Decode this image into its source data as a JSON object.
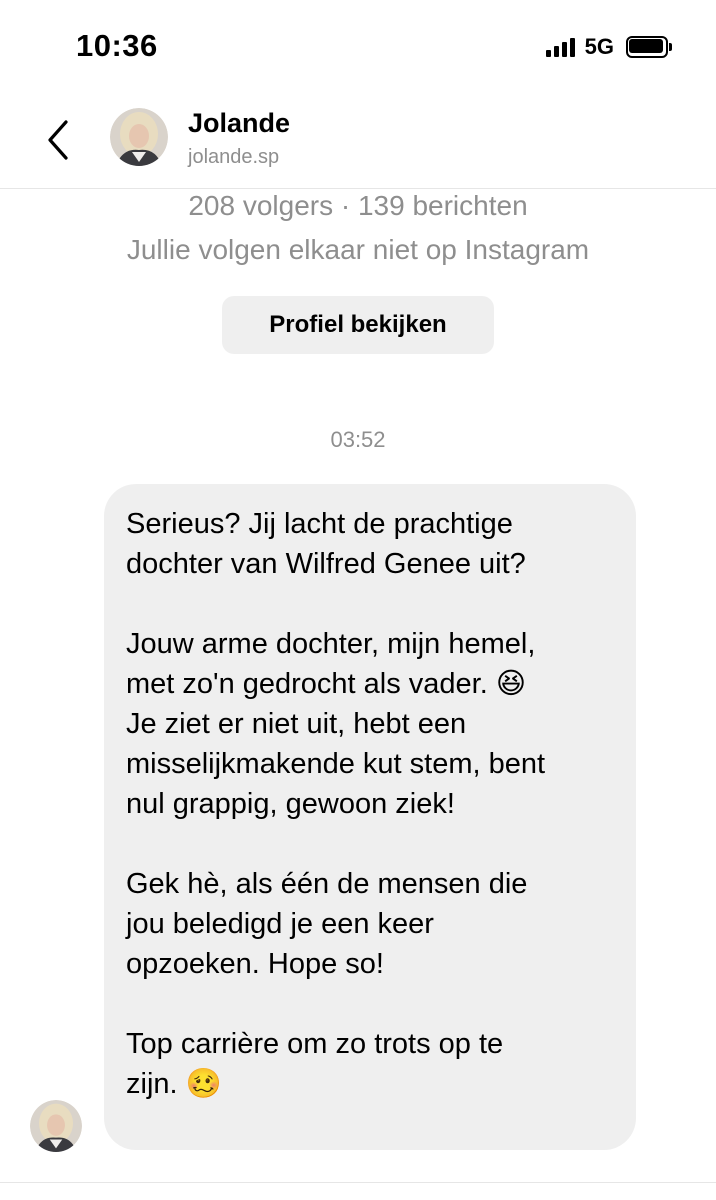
{
  "status_bar": {
    "time": "10:36",
    "network": "5G",
    "battery_level": 1.0
  },
  "header": {
    "back_icon": "chevron-left-icon",
    "name": "Jolande",
    "username": "jolande.sp"
  },
  "profile": {
    "stats": "208 volgers · 139 berichten",
    "follow_note": "Jullie volgen elkaar niet op Instagram",
    "view_profile_label": "Profiel bekijken"
  },
  "conversation": {
    "timestamp": "03:52",
    "message": {
      "paragraphs": [
        "Serieus? Jij lacht de prachtige\ndochter van Wilfred Genee uit?",
        "Jouw arme dochter, mijn hemel,\nmet zo'n gedrocht als vader. 😆\nJe ziet er niet uit, hebt een\nmisselijkmakende kut stem, bent\nnul grappig, gewoon ziek!",
        "Gek hè, als één de mensen die\njou beledigd je een keer\nopzoeken. Hope so!",
        "Top carrière om zo trots op te\nzijn. 🥴"
      ]
    }
  },
  "colors": {
    "background": "#ffffff",
    "bubble": "#efefef",
    "secondary_text": "#8e8e8e",
    "button_bg": "#efefef",
    "divider": "#e6e6e6"
  }
}
